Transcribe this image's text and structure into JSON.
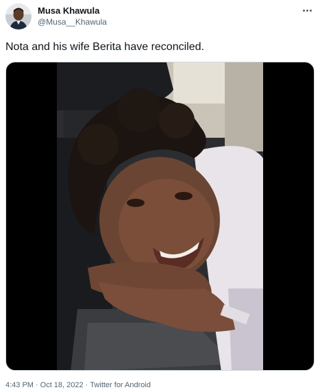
{
  "author": {
    "display_name": "Musa Khawula",
    "handle": "@Musa__Khawula"
  },
  "tweet": {
    "text": "Nota and his wife Berita have reconciled."
  },
  "meta": {
    "time": "4:43 PM",
    "date": "Oct 18, 2022",
    "source": "Twitter for Android",
    "separator": "·"
  },
  "icons": {
    "more": "more-horizontal-icon"
  },
  "colors": {
    "text_primary": "#0f1419",
    "text_secondary": "#536471",
    "media_border": "#cfd9de"
  }
}
